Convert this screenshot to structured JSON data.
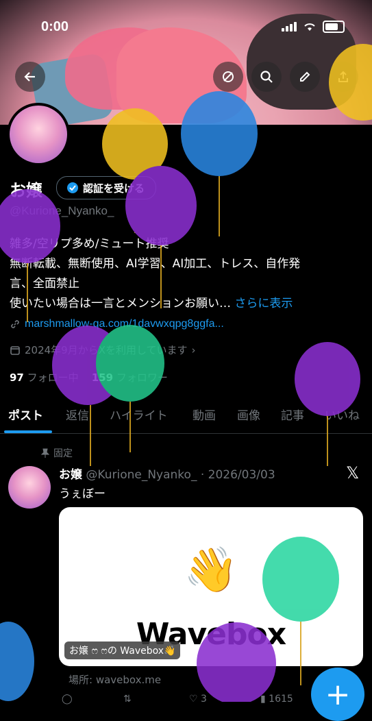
{
  "status_bar": {
    "time": "0:00"
  },
  "profile": {
    "name": "お嬢",
    "verify_button": "認証を受ける",
    "handle": "@Kurione_Nyanko_",
    "bio_lines": [
      "雑多/空リプ多め/ミュート推奨",
      "無断転載、無断使用、AI学習、AI加工、トレス、自作発",
      "言、全面禁止",
      "使いたい場合は一言とメンションお願い…"
    ],
    "bio_more": "さらに表示",
    "link": "marshmallow-qa.com/1davwxqpg8ggfa...",
    "joined": "2024年9月からXを利用しています",
    "following_count": "97",
    "following_label": "フォロー中",
    "followers_count": "159",
    "followers_label": "フォロワー"
  },
  "tabs": [
    "ポスト",
    "返信",
    "ハイライト",
    "動画",
    "画像",
    "記事",
    "いいね"
  ],
  "post": {
    "pinned_label": "固定",
    "author": "お嬢",
    "handle_date": "@Kurione_Nyanko_ · 2026/03/03",
    "text": "うぇぼー",
    "card_wordmark": "Wavebox",
    "card_tag": "お嬢 ෆ ෆの Wavebox👋",
    "source": "場所: wavebox.me",
    "likes": "3",
    "views": "1615"
  },
  "icons": [
    "back-arrow-icon",
    "no-notify-icon",
    "search-icon",
    "edit-icon",
    "share-icon",
    "link-icon",
    "calendar-icon",
    "pin-icon",
    "x-logo-icon",
    "plus-icon",
    "verified-badge-icon"
  ],
  "colors": {
    "accent": "#1d9bf0",
    "background": "#000000",
    "muted": "#71767b"
  }
}
